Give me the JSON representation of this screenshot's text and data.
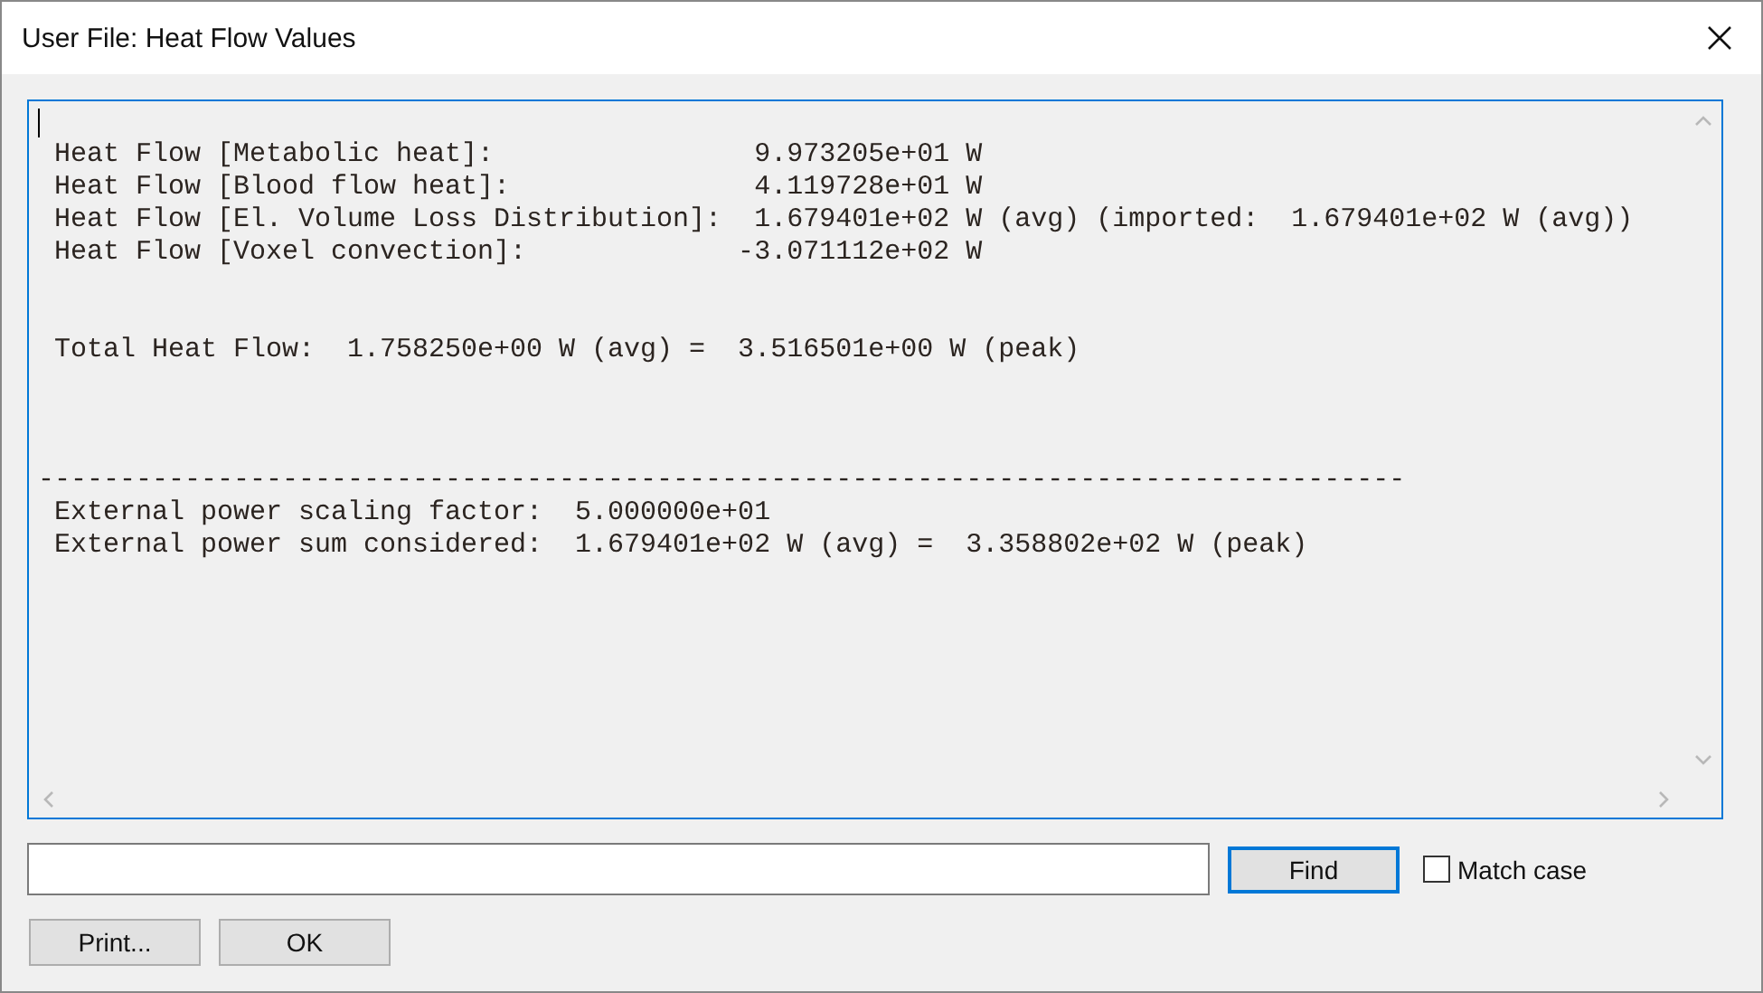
{
  "window": {
    "title": "User File: Heat Flow Values"
  },
  "text_view": {
    "blocks": [
      {
        "lines": [
          {
            "kind": "text",
            "text": "Heat Flow [Metabolic heat]:                9.973205e+01 W"
          },
          {
            "kind": "text",
            "text": "Heat Flow [Blood flow heat]:               4.119728e+01 W"
          },
          {
            "kind": "text",
            "text": "Heat Flow [El. Volume Loss Distribution]:  1.679401e+02 W (avg) (imported:  1.679401e+02 W (avg))"
          },
          {
            "kind": "text",
            "text": "Heat Flow [Voxel convection]:             -3.071112e+02 W"
          }
        ]
      },
      {
        "lines": [
          {
            "kind": "text",
            "text": "Total Heat Flow:  1.758250e+00 W (avg) =  3.516501e+00 W (peak)"
          }
        ]
      },
      {
        "lines": [
          {
            "kind": "rule",
            "text": "------------------------------------------------------------------------------------"
          },
          {
            "kind": "text",
            "text": "External power scaling factor:  5.000000e+01"
          },
          {
            "kind": "text",
            "text": "External power sum considered:  1.679401e+02 W (avg) =  3.358802e+02 W (peak)"
          }
        ]
      }
    ]
  },
  "find": {
    "button": "Find",
    "match_case": {
      "label": "Match case",
      "checked": false
    }
  },
  "buttons": [
    "Print...",
    "OK"
  ]
}
